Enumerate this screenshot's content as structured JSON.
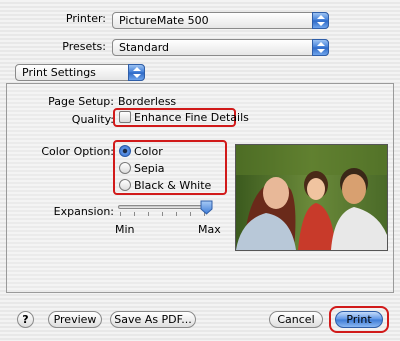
{
  "printer": {
    "label": "Printer:",
    "value": "PictureMate 500"
  },
  "presets": {
    "label": "Presets:",
    "value": "Standard"
  },
  "pane_selector": {
    "value": "Print Settings"
  },
  "settings": {
    "page_setup_label": "Page Setup:",
    "page_setup_value": "Borderless",
    "quality_label": "Quality:",
    "enhance_label": "Enhance Fine Details",
    "enhance_checked": false,
    "color_option_label": "Color Option:",
    "color_options": [
      "Color",
      "Sepia",
      "Black & White"
    ],
    "color_selected": "Color",
    "expansion_label": "Expansion:",
    "expansion_min": "Min",
    "expansion_max": "Max",
    "expansion_level": 1.0
  },
  "footer": {
    "help_symbol": "?",
    "preview_label": "Preview",
    "save_pdf_label": "Save As PDF...",
    "cancel_label": "Cancel",
    "print_label": "Print"
  },
  "colors": {
    "highlight": "#d11a1a",
    "accent": "#3d7bd6"
  }
}
